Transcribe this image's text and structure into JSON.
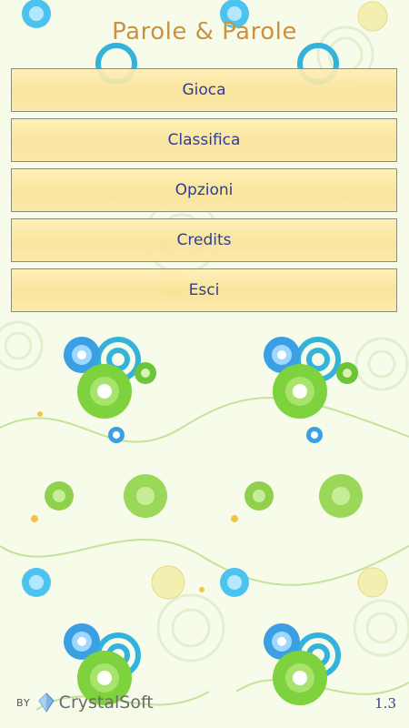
{
  "app": {
    "title": "Parole & Parole"
  },
  "menu": {
    "items": [
      {
        "label": "Gioca"
      },
      {
        "label": "Classifica"
      },
      {
        "label": "Opzioni"
      },
      {
        "label": "Credits"
      },
      {
        "label": "Esci"
      }
    ]
  },
  "footer": {
    "by_label": "BY",
    "brand": "CrystalSoft",
    "version": "1.3"
  },
  "colors": {
    "title": "#c9923e",
    "button_text": "#2f3f8f",
    "button_fill": "#fbe6a8"
  }
}
